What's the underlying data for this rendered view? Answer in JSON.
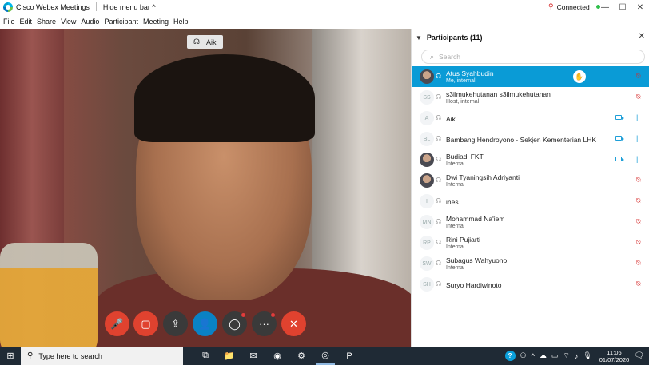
{
  "titlebar": {
    "app_title": "Cisco Webex Meetings",
    "hide_menu_label": "Hide menu bar ^",
    "connection_status": "Connected",
    "status_dot_color": "#2fbf4b",
    "window_buttons": [
      "—",
      "☐",
      "✕"
    ]
  },
  "menubar": {
    "items": [
      "File",
      "Edit",
      "Share",
      "View",
      "Audio",
      "Participant",
      "Meeting",
      "Help"
    ]
  },
  "video": {
    "speaker_name": "Aik"
  },
  "controls": [
    {
      "name": "mute-button",
      "icon": "microphone-off-icon",
      "glyph": "🎤",
      "color": "#e0422f"
    },
    {
      "name": "video-button",
      "icon": "camera-off-icon",
      "glyph": "▢",
      "color": "#e0422f"
    },
    {
      "name": "share-button",
      "icon": "share-icon",
      "glyph": "⇪",
      "color": "#3a3a3a"
    },
    {
      "name": "participants-button",
      "icon": "participant-icon",
      "glyph": "👤",
      "color": "#0a82c4"
    },
    {
      "name": "chat-button",
      "icon": "chat-icon",
      "glyph": "◯",
      "color": "#3a3a3a",
      "badge": true
    },
    {
      "name": "more-options-button",
      "icon": "more-icon",
      "glyph": "···",
      "color": "#3a3a3a",
      "badge": true
    },
    {
      "name": "leave-meeting-button",
      "icon": "close-icon",
      "glyph": "✕",
      "color": "#e0422f"
    }
  ],
  "participants": {
    "title": "Participants (11)",
    "search_placeholder": "Search",
    "rows": [
      {
        "initials": "",
        "photo": true,
        "name": "Atus Syahbudin",
        "sub": "Me, internal",
        "selected": true,
        "raise": true,
        "cam": false,
        "mic": "muted"
      },
      {
        "initials": "SS",
        "photo": false,
        "name": "s3ilmukehutanan s3ilmukehutanan",
        "sub": "Host, internal",
        "selected": false,
        "raise": false,
        "cam": false,
        "mic": "muted"
      },
      {
        "initials": "A",
        "photo": false,
        "name": "Aik",
        "sub": "",
        "selected": false,
        "raise": false,
        "cam": true,
        "mic": "live"
      },
      {
        "initials": "BL",
        "photo": false,
        "name": "Bambang Hendroyono - Sekjen Kementerian LHK",
        "sub": "",
        "selected": false,
        "raise": false,
        "cam": true,
        "mic": "live"
      },
      {
        "initials": "",
        "photo": true,
        "name": "Budiadi FKT",
        "sub": "Internal",
        "selected": false,
        "raise": false,
        "cam": true,
        "mic": "live"
      },
      {
        "initials": "",
        "photo": true,
        "name": "Dwi Tyaningsih Adriyanti",
        "sub": "Internal",
        "selected": false,
        "raise": false,
        "cam": false,
        "mic": "muted"
      },
      {
        "initials": "I",
        "photo": false,
        "name": "ines",
        "sub": "",
        "selected": false,
        "raise": false,
        "cam": false,
        "mic": "muted"
      },
      {
        "initials": "MN",
        "photo": false,
        "name": "Mohammad Na'iem",
        "sub": "Internal",
        "selected": false,
        "raise": false,
        "cam": false,
        "mic": "muted"
      },
      {
        "initials": "RP",
        "photo": false,
        "name": "Rini Pujiarti",
        "sub": "Internal",
        "selected": false,
        "raise": false,
        "cam": false,
        "mic": "muted"
      },
      {
        "initials": "SW",
        "photo": false,
        "name": "Subagus Wahyuono",
        "sub": "Internal",
        "selected": false,
        "raise": false,
        "cam": false,
        "mic": "muted"
      },
      {
        "initials": "SH",
        "photo": false,
        "name": "Suryo Hardiwinoto",
        "sub": "",
        "selected": false,
        "raise": false,
        "cam": false,
        "mic": "muted"
      }
    ]
  },
  "taskbar": {
    "search_placeholder": "Type here to search",
    "apps": [
      {
        "name": "task-view-icon",
        "glyph": "⧉",
        "active": false
      },
      {
        "name": "file-explorer-icon",
        "glyph": "📁",
        "active": false
      },
      {
        "name": "mail-icon",
        "glyph": "✉",
        "active": false
      },
      {
        "name": "chrome-icon",
        "glyph": "◉",
        "active": false
      },
      {
        "name": "settings-icon",
        "glyph": "⚙",
        "active": false
      },
      {
        "name": "webex-icon",
        "glyph": "◎",
        "active": true
      },
      {
        "name": "powerpoint-icon",
        "glyph": "P",
        "active": false
      }
    ],
    "clock_time": "11:06",
    "clock_date": "01/07/2020"
  }
}
